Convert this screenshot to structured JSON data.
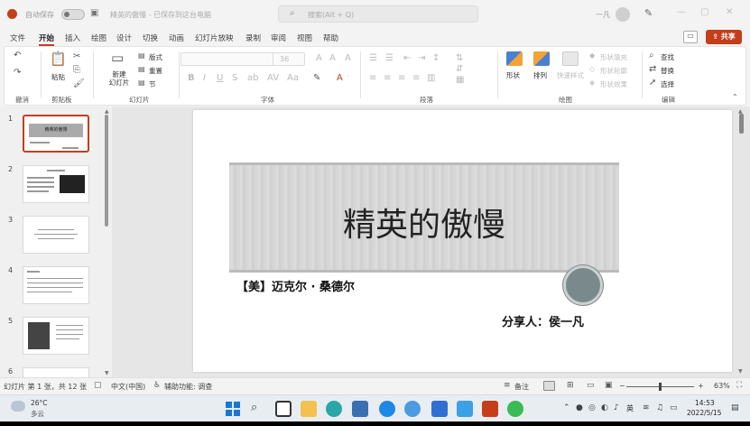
{
  "titlebar": {
    "autosave_label": "自动保存",
    "doc_title": "精英的傲慢 - 已保存到这台电脑",
    "search_placeholder": "搜索(Alt + Q)",
    "user_name": "一凡"
  },
  "menu": {
    "tabs": [
      "文件",
      "开始",
      "插入",
      "绘图",
      "设计",
      "切换",
      "动画",
      "幻灯片放映",
      "录制",
      "审阅",
      "视图",
      "帮助"
    ],
    "active_tab": "开始",
    "share_label": "共享"
  },
  "ribbon": {
    "groups": {
      "undo": "撤消",
      "clipboard": "剪贴板",
      "slides": "幻灯片",
      "font": "字体",
      "paragraph": "段落",
      "drawing": "绘图",
      "editing": "编辑"
    },
    "paste_label": "粘贴",
    "new_slide_label": "新建\n幻灯片",
    "layout_label": "版式",
    "reset_label": "重置",
    "section_label": "节",
    "font_size": "36",
    "shapes_label": "形状",
    "arrange_label": "排列",
    "quick_styles_label": "快速样式",
    "fill_label": "形状填充",
    "outline_label": "形状轮廓",
    "effects_label": "形状效果",
    "find_label": "查找",
    "replace_label": "替换",
    "select_label": "选择"
  },
  "thumbnails": {
    "numbers": [
      "1",
      "2",
      "3",
      "4",
      "5",
      "6"
    ],
    "slide1_title": "精英的傲慢"
  },
  "slide": {
    "title": "精英的傲慢",
    "author": "【美】迈克尔 · 桑德尔",
    "sharer": "分享人：侯一凡"
  },
  "status": {
    "slide_info": "幻灯片 第 1 张，共 12 张",
    "language": "中文(中国)",
    "accessibility": "辅助功能: 调查",
    "notes": "备注",
    "zoom": "63%"
  },
  "taskbar": {
    "temperature": "26°C",
    "weather": "多云",
    "ime": "英",
    "time": "14:53",
    "date": "2022/5/15"
  },
  "colors": {
    "accent": "#c43e1c",
    "ribbon_bg": "#ffffff",
    "window_bg": "#f3f3f3"
  }
}
